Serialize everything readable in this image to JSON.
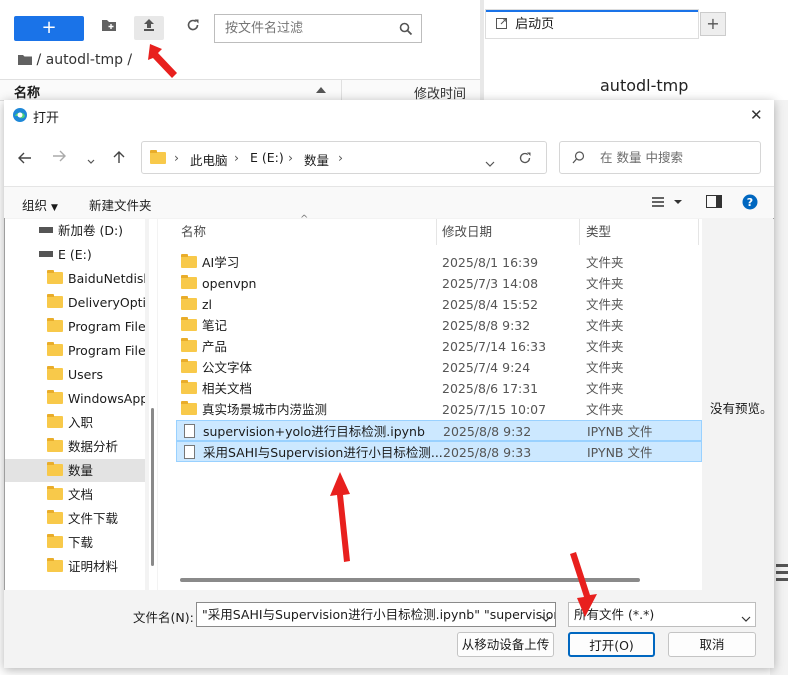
{
  "jupyter": {
    "new_btn": "+",
    "filter_placeholder": "按文件名过滤",
    "breadcrumb": "/ autodl-tmp /",
    "col_name": "名称",
    "col_modified": "修改时间",
    "tab_label": "启动页",
    "launcher_title": "autodl-tmp"
  },
  "dialog": {
    "title": "打开",
    "address": [
      "此电脑",
      "E (E:)",
      "数量"
    ],
    "search_placeholder": "在 数量 中搜索",
    "organize": "组织",
    "new_folder": "新建文件夹",
    "nav": [
      {
        "label": "新加卷 (D:)",
        "kind": "drive"
      },
      {
        "label": "E (E:)",
        "kind": "drive"
      },
      {
        "label": "BaiduNetdisk",
        "kind": "folder"
      },
      {
        "label": "DeliveryOptim",
        "kind": "folder"
      },
      {
        "label": "Program Files",
        "kind": "folder"
      },
      {
        "label": "Program Files",
        "kind": "folder"
      },
      {
        "label": "Users",
        "kind": "folder"
      },
      {
        "label": "WindowsApps",
        "kind": "folder"
      },
      {
        "label": "入职",
        "kind": "folder"
      },
      {
        "label": "数据分析",
        "kind": "folder"
      },
      {
        "label": "数量",
        "kind": "folder",
        "selected": true
      },
      {
        "label": "文档",
        "kind": "folder"
      },
      {
        "label": "文件下载",
        "kind": "folder"
      },
      {
        "label": "下载",
        "kind": "folder"
      },
      {
        "label": "证明材料",
        "kind": "folder"
      }
    ],
    "columns": {
      "name": "名称",
      "date": "修改日期",
      "type": "类型"
    },
    "files": [
      {
        "name": "AI学习",
        "date": "2025/8/1 16:39",
        "type": "文件夹",
        "kind": "folder"
      },
      {
        "name": "openvpn",
        "date": "2025/7/3 14:08",
        "type": "文件夹",
        "kind": "folder"
      },
      {
        "name": "zl",
        "date": "2025/8/4 15:52",
        "type": "文件夹",
        "kind": "folder"
      },
      {
        "name": "笔记",
        "date": "2025/8/8 9:32",
        "type": "文件夹",
        "kind": "folder"
      },
      {
        "name": "产品",
        "date": "2025/7/14 16:33",
        "type": "文件夹",
        "kind": "folder"
      },
      {
        "name": "公文字体",
        "date": "2025/7/4 9:24",
        "type": "文件夹",
        "kind": "folder"
      },
      {
        "name": "相关文档",
        "date": "2025/8/6 17:31",
        "type": "文件夹",
        "kind": "folder"
      },
      {
        "name": "真实场景城市内涝监测",
        "date": "2025/7/15 10:07",
        "type": "文件夹",
        "kind": "folder"
      },
      {
        "name": "supervision+yolo进行目标检测.ipynb",
        "date": "2025/8/8 9:32",
        "type": "IPYNB 文件",
        "kind": "file",
        "selected": true
      },
      {
        "name": "采用SAHI与Supervision进行小目标检测...",
        "date": "2025/8/8 9:33",
        "type": "IPYNB 文件",
        "kind": "file",
        "selected": true
      }
    ],
    "preview_text": "没有预览。",
    "filename_label": "文件名(N):",
    "filename_value": "\"采用SAHI与Supervision进行小目标检测.ipynb\" \"supervision",
    "filetype_value": "所有文件 (*.*)",
    "upload_btn": "从移动设备上传",
    "open_btn": "打开(O)",
    "cancel_btn": "取消",
    "close_icon": "✕"
  },
  "colors": {
    "accent": "#1a73e8",
    "selection": "#cce8ff",
    "arrow": "#e8201e"
  }
}
